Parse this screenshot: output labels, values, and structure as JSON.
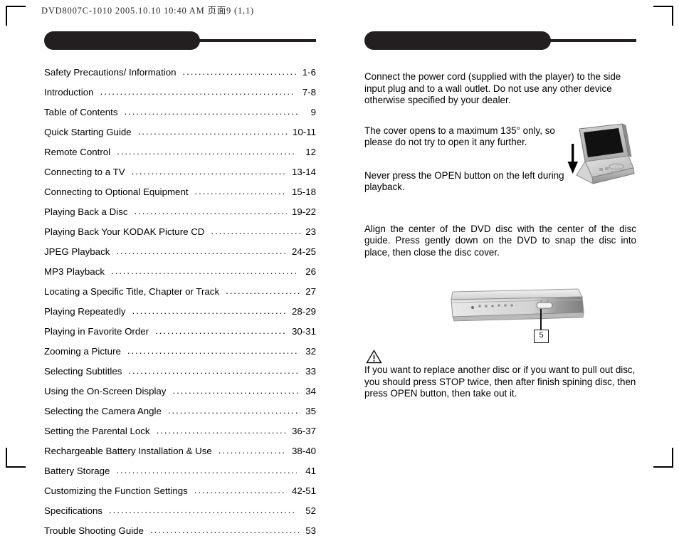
{
  "print_slug": "DVD8007C-1010  2005.10.10 10:40 AM  页面9 (1,1)",
  "left_page": {
    "header": {
      "pill_label": ""
    },
    "toc": {
      "leader": "..................................................................................................",
      "entries": [
        {
          "title": "Safety Precautions/ Information",
          "pages": "1-6"
        },
        {
          "title": "Introduction",
          "pages": "7-8"
        },
        {
          "title": "Table of Contents",
          "pages": "9"
        },
        {
          "title": "Quick Starting Guide",
          "pages": "10-11"
        },
        {
          "title": "Remote Control",
          "pages": "12"
        },
        {
          "title": "Connecting to a TV",
          "pages": "13-14"
        },
        {
          "title": "Connecting to Optional Equipment",
          "pages": "15-18"
        },
        {
          "title": "Playing Back a Disc",
          "pages": "19-22"
        },
        {
          "title": "Playing Back Your KODAK Picture CD",
          "pages": "23"
        },
        {
          "title": "JPEG Playback",
          "pages": "24-25"
        },
        {
          "title": "MP3 Playback",
          "pages": "26"
        },
        {
          "title": "Locating a Specific Title, Chapter or Track",
          "pages": "27"
        },
        {
          "title": "Playing Repeatedly",
          "pages": "28-29"
        },
        {
          "title": "Playing in Favorite Order",
          "pages": "30-31"
        },
        {
          "title": "Zooming a Picture",
          "pages": "32"
        },
        {
          "title": "Selecting Subtitles",
          "pages": "33"
        },
        {
          "title": "Using the On-Screen Display",
          "pages": "34"
        },
        {
          "title": "Selecting the Camera Angle",
          "pages": "35"
        },
        {
          "title": "Setting the Parental Lock",
          "pages": "36-37"
        },
        {
          "title": "Rechargeable Battery Installation & Use",
          "pages": "38-40"
        },
        {
          "title": "Battery Storage",
          "pages": "41"
        },
        {
          "title": "Customizing the Function Settings",
          "pages": "42-51"
        },
        {
          "title": "Specifications",
          "pages": "52"
        },
        {
          "title": "Trouble Shooting Guide",
          "pages": "53"
        }
      ]
    }
  },
  "right_page": {
    "header": {
      "pill_label": ""
    },
    "intro_paragraph": "Connect the power cord (supplied with the player) to the side input plug and to a wall outlet. Do not use any other device otherwise specified by your dealer.",
    "cover_paragraph": "The cover opens to a maximum 135° only, so please do not try to open it any further.",
    "open_button_paragraph": "Never press the OPEN button on the left during playback.",
    "align_paragraph": "Align the center of the DVD disc with the center of the disc guide. Press gently down on the DVD to snap the disc into place, then close the disc cover.",
    "callout_label": "5",
    "warning_paragraph": "If you want to replace another disc or if you want to pull out disc, you should press STOP twice, then after finish spining disc, then press OPEN button, then take out it."
  },
  "colors": {
    "ink": "#231f20",
    "page_background": "#ffffff"
  }
}
